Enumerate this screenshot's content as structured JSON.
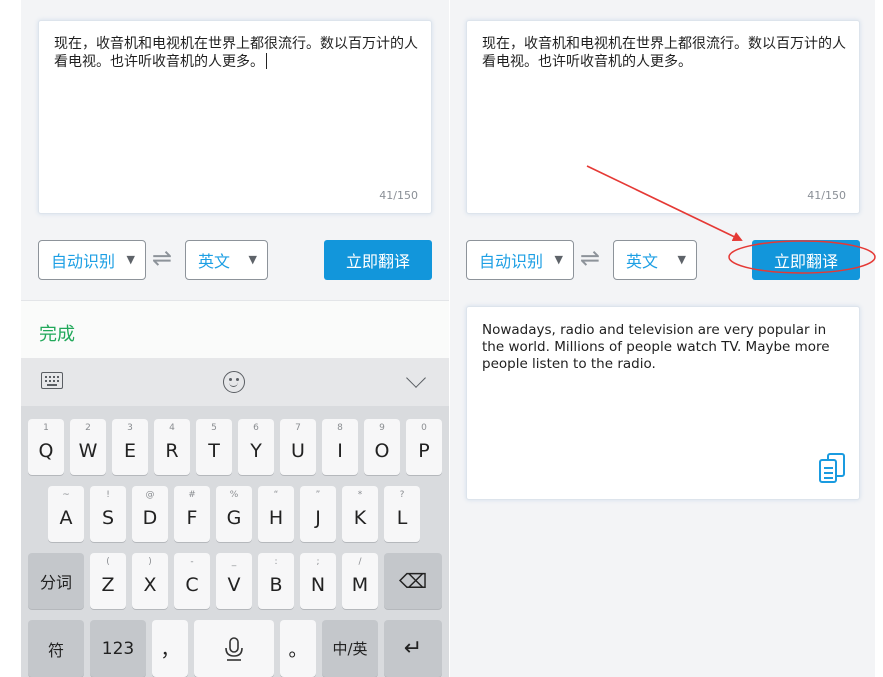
{
  "source_text": "现在，收音机和电视机在世界上都很流行。数以百万计的人看电视。也许听收音机的人更多。",
  "char_counter": "41/150",
  "source_lang": "自动识别",
  "target_lang": "英文",
  "swap_symbol": "⇌",
  "dropdown_symbol": "▼",
  "translate_label": "立即翻译",
  "done_label": "完成",
  "output_text": "Nowadays, radio and television are very popular in the world. Millions of people watch TV. Maybe more people listen to the radio.",
  "keyboard": {
    "row1": [
      {
        "alt": "1",
        "main": "Q"
      },
      {
        "alt": "2",
        "main": "W"
      },
      {
        "alt": "3",
        "main": "E"
      },
      {
        "alt": "4",
        "main": "R"
      },
      {
        "alt": "5",
        "main": "T"
      },
      {
        "alt": "6",
        "main": "Y"
      },
      {
        "alt": "7",
        "main": "U"
      },
      {
        "alt": "8",
        "main": "I"
      },
      {
        "alt": "9",
        "main": "O"
      },
      {
        "alt": "0",
        "main": "P"
      }
    ],
    "row2": [
      {
        "alt": "~",
        "main": "A"
      },
      {
        "alt": "!",
        "main": "S"
      },
      {
        "alt": "@",
        "main": "D"
      },
      {
        "alt": "#",
        "main": "F"
      },
      {
        "alt": "%",
        "main": "G"
      },
      {
        "alt": "“",
        "main": "H"
      },
      {
        "alt": "”",
        "main": "J"
      },
      {
        "alt": "*",
        "main": "K"
      },
      {
        "alt": "?",
        "main": "L"
      }
    ],
    "row3": [
      {
        "alt": "(",
        "main": "Z"
      },
      {
        "alt": ")",
        "main": "X"
      },
      {
        "alt": "-",
        "main": "C"
      },
      {
        "alt": "_",
        "main": "V"
      },
      {
        "alt": ":",
        "main": "B"
      },
      {
        "alt": ";",
        "main": "N"
      },
      {
        "alt": "/",
        "main": "M"
      }
    ],
    "fenci": "分词",
    "backspace": "⌫",
    "fu": "符",
    "num": "123",
    "comma": "，",
    "period": "。",
    "lang_switch": "中/英",
    "enter": "↵"
  },
  "colors": {
    "accent": "#1296db",
    "done_green": "#21a85a",
    "arrow_red": "#e53935"
  }
}
